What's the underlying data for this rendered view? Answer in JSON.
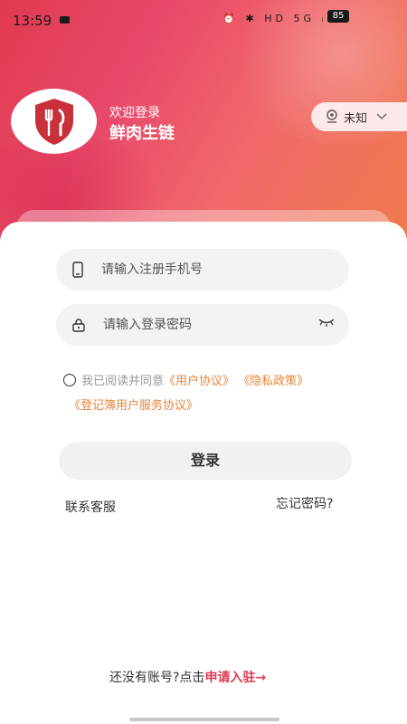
{
  "status_bar": {
    "time": "13:59",
    "icons": "⏰ ✱ HD 5G ᵢₗ ≋",
    "battery": "85"
  },
  "header": {
    "welcome": "欢迎登录",
    "app_name": "鲜肉生链",
    "location_label": "未知"
  },
  "form": {
    "phone_placeholder": "请输入注册手机号",
    "password_placeholder": "请输入登录密码",
    "agree_prefix": "我已阅读并同意",
    "user_agreement": "《用户协议》",
    "privacy_policy": "《隐私政策》",
    "service_agreement": "《登记簿用户服务协议》",
    "login_label": "登录",
    "contact_label": "联系客服",
    "forgot_label": "忘记密码?"
  },
  "footer": {
    "signup_prefix": "还没有账号?点击",
    "apply_label": "申请入驻→"
  },
  "colors": {
    "accent": "#e03a4f",
    "link": "#e8843a"
  }
}
